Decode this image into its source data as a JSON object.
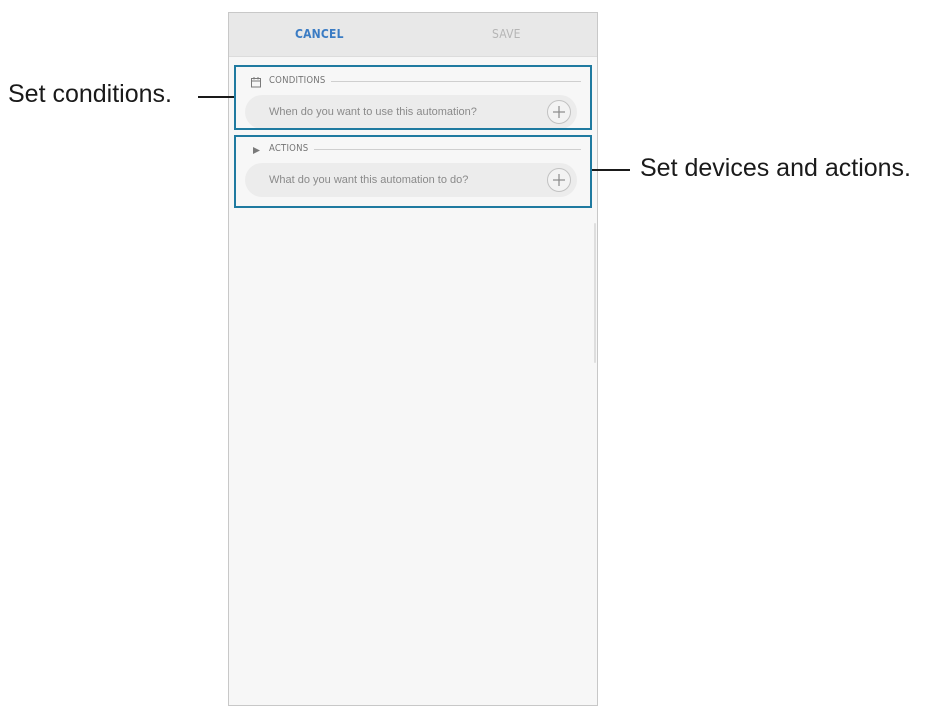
{
  "toolbar": {
    "cancel_label": "CANCEL",
    "save_label": "SAVE"
  },
  "conditions": {
    "icon": "calendar-icon",
    "label": "CONDITIONS",
    "prompt": "When do you want to use this automation?",
    "add_icon": "plus-icon"
  },
  "actions": {
    "icon": "play-icon",
    "label": "ACTIONS",
    "prompt": "What do you want this automation to do?",
    "add_icon": "plus-icon"
  },
  "callouts": {
    "conditions": "Set conditions.",
    "actions": "Set devices and actions."
  },
  "colors": {
    "accent": "#3b7cc4",
    "disabled": "#b5b5b5",
    "callout_border": "#1f7aa0"
  }
}
